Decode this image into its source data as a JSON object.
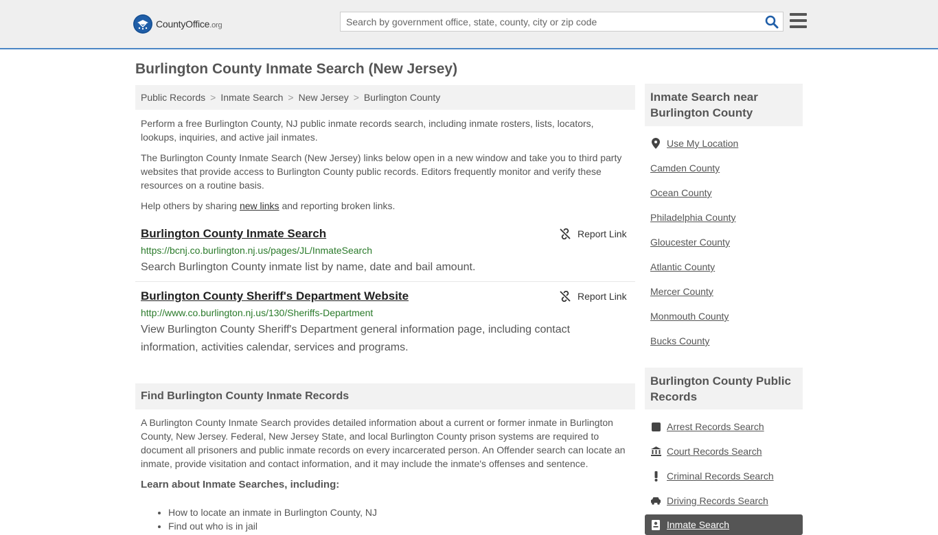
{
  "header": {
    "logo_text": "CountyOffice",
    "logo_suffix": ".org",
    "search_placeholder": "Search by government office, state, county, city or zip code",
    "search_icon": "search-icon",
    "menu_icon": "hamburger-menu-icon",
    "accent_color": "#4a86c5"
  },
  "page": {
    "title": "Burlington County Inmate Search (New Jersey)"
  },
  "breadcrumb": [
    {
      "label": "Public Records"
    },
    {
      "label": "Inmate Search"
    },
    {
      "label": "New Jersey"
    },
    {
      "label": "Burlington County"
    }
  ],
  "intro": {
    "p1": "Perform a free Burlington County, NJ public inmate records search, including inmate rosters, lists, locators, lookups, inquiries, and active jail inmates.",
    "p2": "The Burlington County Inmate Search (New Jersey) links below open in a new window and take you to third party websites that provide access to Burlington County public records. Editors frequently monitor and verify these resources on a routine basis.",
    "p3_before": "Help others by sharing ",
    "p3_link": "new links",
    "p3_after": " and reporting broken links."
  },
  "results": [
    {
      "title": "Burlington County Inmate Search",
      "report_label": "Report Link",
      "url": "https://bcnj.co.burlington.nj.us/pages/JL/InmateSearch",
      "description": "Search Burlington County inmate list by name, date and bail amount."
    },
    {
      "title": "Burlington County Sheriff's Department Website",
      "report_label": "Report Link",
      "url": "http://www.co.burlington.nj.us/130/Sheriffs-Department",
      "description": "View Burlington County Sheriff's Department general information page, including contact information, activities calendar, services and programs."
    }
  ],
  "find_section": {
    "heading": "Find Burlington County Inmate Records",
    "body": "A Burlington County Inmate Search provides detailed information about a current or former inmate in Burlington County, New Jersey. Federal, New Jersey State, and local Burlington County prison systems are required to document all prisoners and public inmate records on every incarcerated person. An Offender search can locate an inmate, provide visitation and contact information, and it may include the inmate's offenses and sentence.",
    "learn_heading": "Learn about Inmate Searches, including:",
    "bullets": [
      "How to locate an inmate in Burlington County, NJ",
      "Find out who is in jail"
    ]
  },
  "sidebar": {
    "nearby_heading": "Inmate Search near Burlington County",
    "use_location": "Use My Location",
    "nearby": [
      "Camden County",
      "Ocean County",
      "Philadelphia County",
      "Gloucester County",
      "Atlantic County",
      "Mercer County",
      "Monmouth County",
      "Bucks County"
    ],
    "records_heading": "Burlington County Public Records",
    "records": [
      {
        "label": "Arrest Records Search",
        "icon": "square-icon"
      },
      {
        "label": "Court Records Search",
        "icon": "courthouse-icon"
      },
      {
        "label": "Criminal Records Search",
        "icon": "exclamation-icon"
      },
      {
        "label": "Driving Records Search",
        "icon": "car-icon"
      }
    ],
    "active_item": {
      "label": "Inmate Search",
      "icon": "id-card-icon"
    }
  }
}
